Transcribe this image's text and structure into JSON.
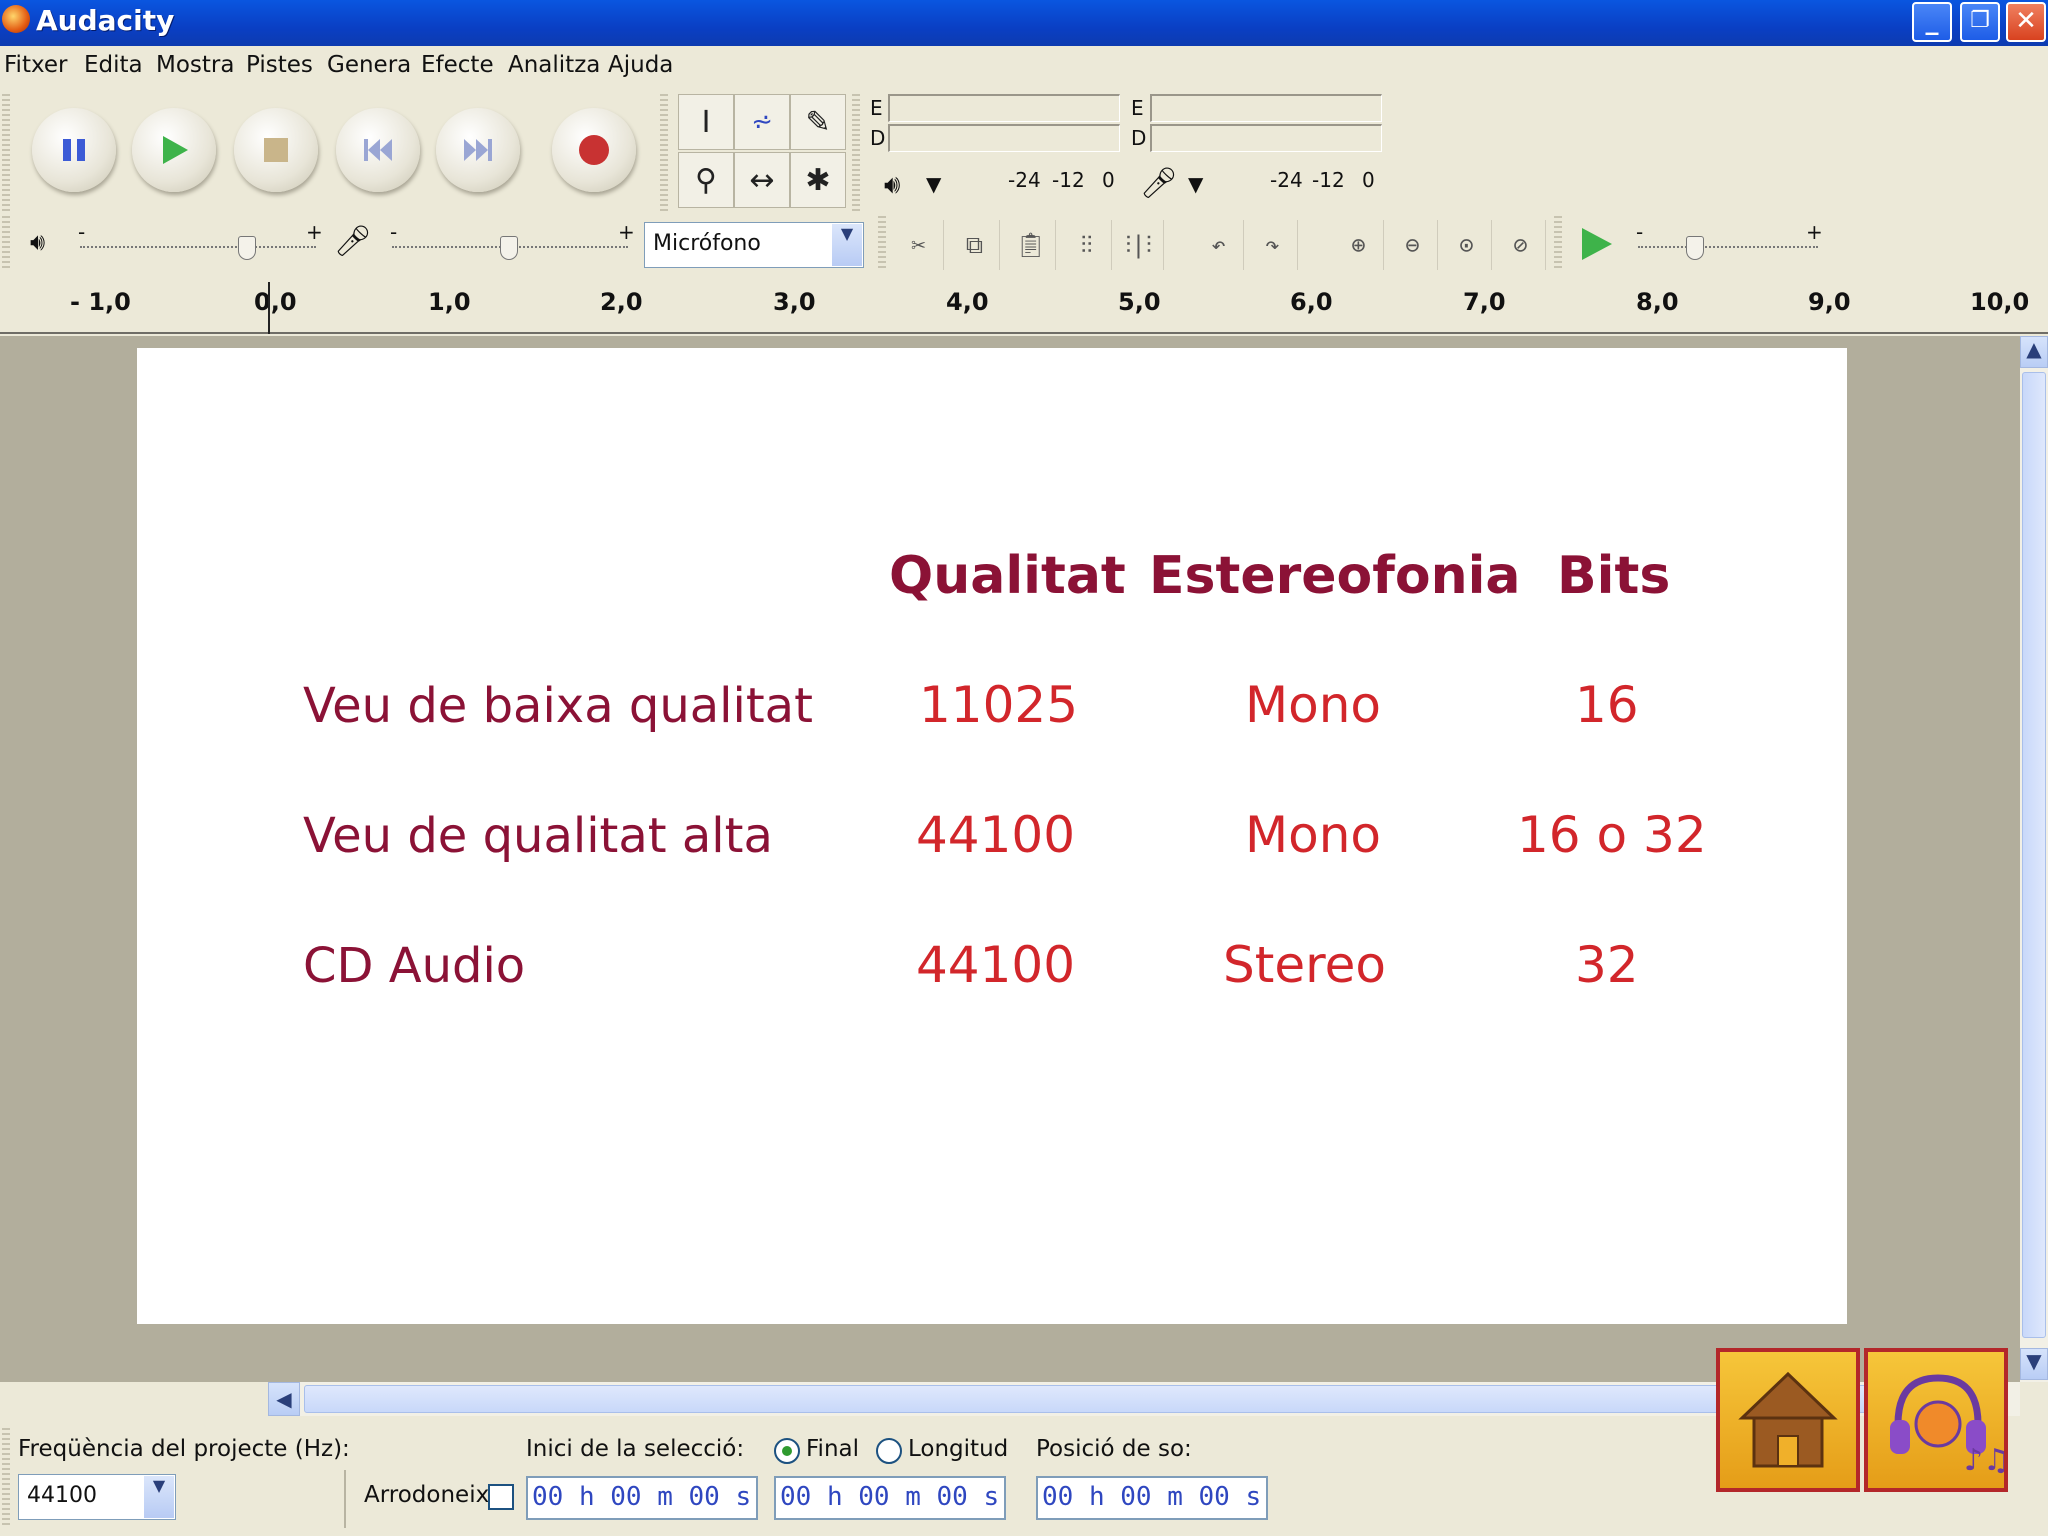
{
  "window": {
    "title": "Audacity"
  },
  "menu": [
    "Fitxer",
    "Edita",
    "Mostra",
    "Pistes",
    "Genera",
    "Efecte",
    "Analitza",
    "Ajuda"
  ],
  "meters": {
    "l_label": "E",
    "r_label": "D",
    "scale_a": "-24",
    "scale_b": "-12",
    "scale_c": "0"
  },
  "input_source": "Micrófono",
  "ruler": [
    "- 1,0",
    "0,0",
    "1,0",
    "2,0",
    "3,0",
    "4,0",
    "5,0",
    "6,0",
    "7,0",
    "8,0",
    "9,0",
    "10,0"
  ],
  "slide": {
    "headers": [
      "Qualitat",
      "Estereofonia",
      "Bits"
    ],
    "rows": [
      {
        "label": "Veu de baixa qualitat",
        "qualitat": "11025",
        "estereofonia": "Mono",
        "bits": "16"
      },
      {
        "label": "Veu de qualitat alta",
        "qualitat": "44100",
        "estereofonia": "Mono",
        "bits": "16 o 32"
      },
      {
        "label": "CD Audio",
        "qualitat": "44100",
        "estereofonia": "Stereo",
        "bits": "32"
      }
    ]
  },
  "status": {
    "freq_label": "Freqüència del projecte (Hz):",
    "freq_value": "44100",
    "selection_label": "Inici de la selecció:",
    "final_label": "Final",
    "longitud_label": "Longitud",
    "position_label": "Posició de so:",
    "snap_label": "Arrodoneix",
    "time_value": "00 h 00 m 00 s"
  },
  "colors": {
    "header": "#8b1236",
    "row_label": "#8b1236",
    "value": "#d2262b"
  }
}
